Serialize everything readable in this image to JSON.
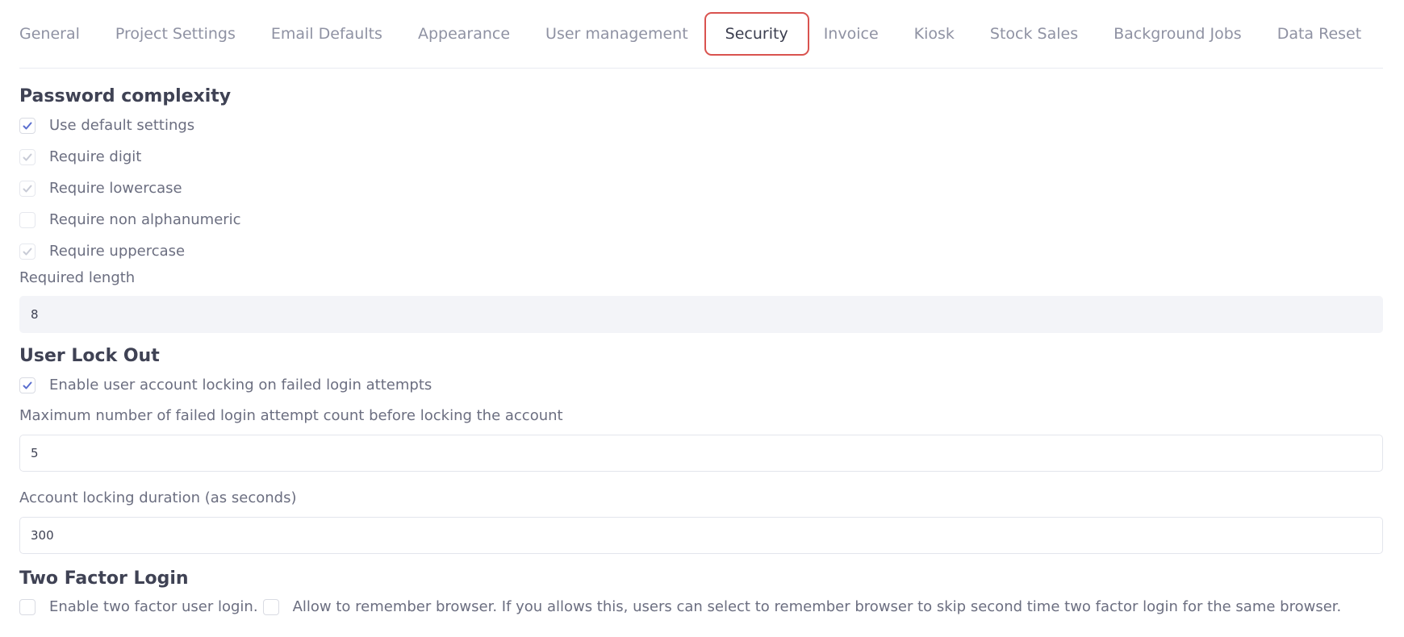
{
  "tabs": [
    {
      "label": "General",
      "active": false
    },
    {
      "label": "Project Settings",
      "active": false
    },
    {
      "label": "Email Defaults",
      "active": false
    },
    {
      "label": "Appearance",
      "active": false
    },
    {
      "label": "User management",
      "active": false
    },
    {
      "label": "Security",
      "active": true
    },
    {
      "label": "Invoice",
      "active": false
    },
    {
      "label": "Kiosk",
      "active": false
    },
    {
      "label": "Stock Sales",
      "active": false
    },
    {
      "label": "Background Jobs",
      "active": false
    },
    {
      "label": "Data Reset",
      "active": false
    }
  ],
  "password_complexity": {
    "title": "Password complexity",
    "options": [
      {
        "label": "Use default settings",
        "checked": true,
        "disabled": false
      },
      {
        "label": "Require digit",
        "checked": true,
        "disabled": true
      },
      {
        "label": "Require lowercase",
        "checked": true,
        "disabled": true
      },
      {
        "label": "Require non alphanumeric",
        "checked": false,
        "disabled": true
      },
      {
        "label": "Require uppercase",
        "checked": true,
        "disabled": true
      }
    ],
    "required_length_label": "Required length",
    "required_length_value": "8"
  },
  "user_lock_out": {
    "title": "User Lock Out",
    "enable_label": "Enable user account locking on failed login attempts",
    "enable_checked": true,
    "max_attempts_label": "Maximum number of failed login attempt count before locking the account",
    "max_attempts_value": "5",
    "duration_label": "Account locking duration (as seconds)",
    "duration_value": "300"
  },
  "two_factor": {
    "title": "Two Factor Login",
    "enable_label": "Enable two factor user login.",
    "enable_checked": false,
    "remember_label": "Allow to remember browser. If you allows this, users can select to remember browser to skip second time two factor login for the same browser.",
    "remember_checked": false
  },
  "colors": {
    "accent": "#5b6fcf",
    "active_tab_border": "#d9534f"
  },
  "icons": {
    "check": "check-icon"
  }
}
